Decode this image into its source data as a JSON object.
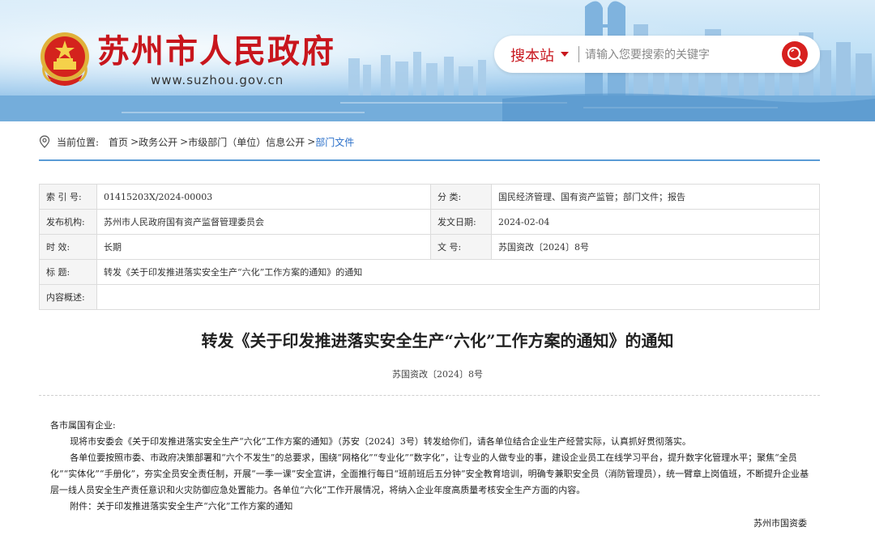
{
  "header": {
    "site_title": "苏州市人民政府",
    "site_url": "www.suzhou.gov.cn",
    "search_scope": "搜本站",
    "search_placeholder": "请输入您要搜索的关键字"
  },
  "breadcrumb": {
    "prefix": "当前位置:",
    "items": [
      "首页",
      "政务公开",
      "市级部门（单位）信息公开"
    ],
    "current": "部门文件",
    "separator": ">"
  },
  "info_table": {
    "index_label": "索 引 号:",
    "index_value": "01415203X/2024-00003",
    "category_label": "分      类:",
    "category_value": "国民经济管理、国有资产监管；部门文件；报告",
    "issuer_label": "发布机构:",
    "issuer_value": "苏州市人民政府国有资产监督管理委员会",
    "date_label": "发文日期:",
    "date_value": "2024-02-04",
    "validity_label": "时      效:",
    "validity_value": "长期",
    "docno_label": "文      号:",
    "docno_value": "苏国资改〔2024〕8号",
    "title_label": "标      题:",
    "title_value": "转发《关于印发推进落实安全生产“六化”工作方案的通知》的通知",
    "summary_label": "内容概述:",
    "summary_value": ""
  },
  "article": {
    "title": "转发《关于印发推进落实安全生产“六化”工作方案的通知》的通知",
    "doc_number": "苏国资改〔2024〕8号",
    "salutation": "各市属国有企业:",
    "paragraph1": "现将市安委会《关于印发推进落实安全生产“六化”工作方案的通知》（苏安〔2024〕3号）转发给你们，请各单位结合企业生产经营实际，认真抓好贯彻落实。",
    "paragraph2": "各单位要按照市委、市政府决策部署和“六个不发生”的总要求，围绕“网格化”“专业化”“数字化”，让专业的人做专业的事，建设企业员工在线学习平台，提升数字化管理水平；聚焦“全员化”“实体化”“手册化”，夯实全员安全责任制，开展“一季一课”安全宣讲，全面推行每日“班前班后五分钟”安全教育培训，明确专兼职安全员（消防管理员），统一臂章上岗值班，不断提升企业基层一线人员安全生产责任意识和火灾防御应急处置能力。各单位“六化”工作开展情况，将纳入企业年度高质量考核安全生产方面的内容。",
    "attachment": "附件：关于印发推进落实安全生产“六化”工作方案的通知",
    "signature": "苏州市国资委"
  },
  "colors": {
    "brand_red": "#c8161d",
    "link_blue": "#2a6fc9",
    "rule_blue": "#5a9bd5"
  },
  "icons": [
    "national-emblem-icon",
    "location-pin-icon",
    "search-icon",
    "dropdown-caret-icon"
  ]
}
